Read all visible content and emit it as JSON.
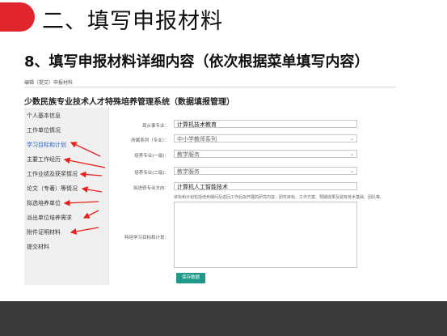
{
  "slide": {
    "title": "二、填写申报材料",
    "subtitle": "8、填写申报材料详细内容（依次根据菜单填写内容）"
  },
  "app": {
    "breadcrumb": "编辑（提交）申报材料",
    "title": "少数民族专业技术人才特殊培养管理系统（数据填报管理）"
  },
  "sidebar": {
    "items": [
      {
        "label": "个人基本信息"
      },
      {
        "label": "工作单位情况"
      },
      {
        "label": "学习目标和计划",
        "active": true
      },
      {
        "label": "主要工作经历"
      },
      {
        "label": "工作业绩及获奖情况"
      },
      {
        "label": "论文（专著）等情况"
      },
      {
        "label": "拟选培养单位"
      },
      {
        "label": "派出单位培养需求"
      },
      {
        "label": "附件证明材料"
      },
      {
        "label": "提交材料"
      }
    ]
  },
  "form": {
    "field1": {
      "label": "现从事专业：",
      "value": "计算机技术教育"
    },
    "field2": {
      "label": "所属系列（专业）：",
      "value": "中小学教师系列"
    },
    "field3": {
      "label": "培养专业(一级)：",
      "value": "教学服务"
    },
    "field4": {
      "label": "培养专业(二级)：",
      "value": "教学服务"
    },
    "field5": {
      "label": "拟进修专业方向：",
      "value": "计算机人工智能技术"
    },
    "plan": {
      "label": "特培学习目标和计划：",
      "hint": "目标和计划包括培养期间及返回工作后拟开展的研究内容、研究目标、工作方案、预期成果及需有技术基础、团队等。",
      "value": ""
    },
    "save_label": "保存数据"
  },
  "colors": {
    "accent_red": "#e0252d",
    "active_link": "#2a62c9",
    "save_button": "#1f9a8a",
    "arrow_red": "#e8201d",
    "bottom_band": "#3a3a3a"
  }
}
